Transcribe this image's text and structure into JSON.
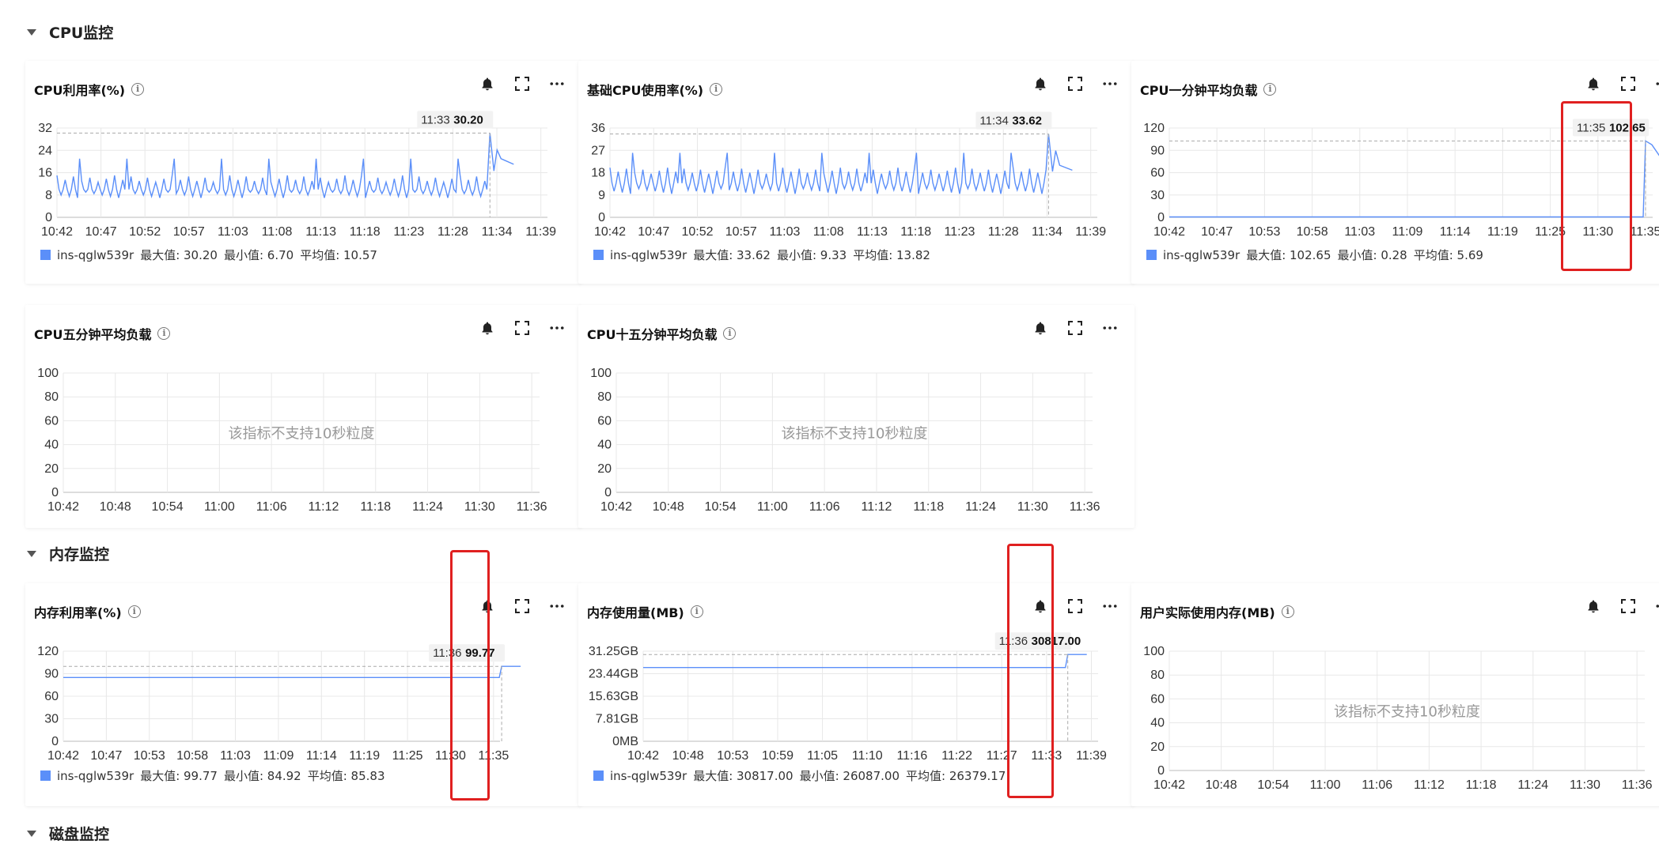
{
  "sections": {
    "cpu": {
      "title": "CPU监控"
    },
    "memory": {
      "title": "内存监控"
    },
    "disk": {
      "title": "磁盘监控"
    }
  },
  "no_data_text": "该指标不支持10秒粒度",
  "icons": {
    "alert": "bell-icon",
    "fullscreen": "fullscreen-icon",
    "more": "more-icon",
    "info": "info-icon"
  },
  "colors": {
    "series": "#5b8ff9",
    "highlight": "#e02020",
    "grid": "#e8e8e8"
  },
  "cards": [
    {
      "title": "CPU利用率(%)",
      "legend": {
        "series": "ins-qglw539r",
        "max": "最大值: 30.20",
        "min": "最小值: 6.70",
        "avg": "平均值: 10.57"
      },
      "tooltip": {
        "time": "11:33",
        "value": "30.20"
      }
    },
    {
      "title": "基础CPU使用率(%)",
      "legend": {
        "series": "ins-qglw539r",
        "max": "最大值: 33.62",
        "min": "最小值: 9.33",
        "avg": "平均值: 13.82"
      },
      "tooltip": {
        "time": "11:34",
        "value": "33.62"
      }
    },
    {
      "title": "CPU一分钟平均负载",
      "legend": {
        "series": "ins-qglw539r",
        "max": "最大值: 102.65",
        "min": "最小值: 0.28",
        "avg": "平均值: 5.69"
      },
      "tooltip": {
        "time": "11:35",
        "value": "102.65"
      }
    },
    {
      "title": "CPU五分钟平均负载"
    },
    {
      "title": "CPU十五分钟平均负载"
    },
    {
      "title": "内存利用率(%)",
      "legend": {
        "series": "ins-qglw539r",
        "max": "最大值: 99.77",
        "min": "最小值: 84.92",
        "avg": "平均值: 85.83"
      },
      "tooltip": {
        "time": "11:36",
        "value": "99.77"
      }
    },
    {
      "title": "内存使用量(MB)",
      "legend": {
        "series": "ins-qglw539r",
        "max": "最大值: 30817.00",
        "min": "最小值: 26087.00",
        "avg": "平均值: 26379.17"
      },
      "tooltip": {
        "time": "11:36",
        "value": "30817.00"
      }
    },
    {
      "title": "用户实际使用内存(MB)"
    }
  ],
  "chart_data": [
    {
      "type": "line",
      "title": "CPU利用率(%)",
      "yticks": [
        "0",
        "8",
        "16",
        "24",
        "32"
      ],
      "ylim": [
        0,
        32
      ],
      "xticks": [
        "10:42",
        "10:47",
        "10:52",
        "10:57",
        "11:03",
        "11:08",
        "11:13",
        "11:18",
        "11:23",
        "11:28",
        "11:34",
        "11:39"
      ],
      "series": [
        {
          "name": "ins-qglw539r",
          "pattern": "oscillating",
          "low": 7,
          "high": 15,
          "spike_at": "11:33",
          "spike_value": 30.2,
          "end_value": 19
        }
      ]
    },
    {
      "type": "line",
      "title": "基础CPU使用率(%)",
      "yticks": [
        "0",
        "9",
        "18",
        "27",
        "36"
      ],
      "ylim": [
        0,
        36
      ],
      "xticks": [
        "10:42",
        "10:47",
        "10:52",
        "10:57",
        "11:03",
        "11:08",
        "11:13",
        "11:18",
        "11:23",
        "11:28",
        "11:34",
        "11:39"
      ],
      "series": [
        {
          "name": "ins-qglw539r",
          "pattern": "oscillating",
          "low": 9.5,
          "high": 20,
          "spike_at": "11:34",
          "spike_value": 33.62,
          "end_value": 19
        }
      ]
    },
    {
      "type": "line",
      "title": "CPU一分钟平均负载",
      "yticks": [
        "0",
        "30",
        "60",
        "90",
        "120"
      ],
      "ylim": [
        0,
        120
      ],
      "xticks": [
        "10:42",
        "10:47",
        "10:53",
        "10:58",
        "11:03",
        "11:09",
        "11:14",
        "11:19",
        "11:25",
        "11:30",
        "11:35"
      ],
      "series": [
        {
          "name": "ins-qglw539r",
          "pattern": "flat",
          "low": 0.5,
          "spike_at": "11:35",
          "spike_value": 102.65,
          "end_value": 82
        }
      ]
    },
    {
      "type": "line",
      "title": "CPU五分钟平均负载",
      "yticks": [
        "0",
        "20",
        "40",
        "60",
        "80",
        "100"
      ],
      "ylim": [
        0,
        100
      ],
      "xticks": [
        "10:42",
        "10:48",
        "10:54",
        "11:00",
        "11:06",
        "11:12",
        "11:18",
        "11:24",
        "11:30",
        "11:36"
      ],
      "series": []
    },
    {
      "type": "line",
      "title": "CPU十五分钟平均负载",
      "yticks": [
        "0",
        "20",
        "40",
        "60",
        "80",
        "100"
      ],
      "ylim": [
        0,
        100
      ],
      "xticks": [
        "10:42",
        "10:48",
        "10:54",
        "11:00",
        "11:06",
        "11:12",
        "11:18",
        "11:24",
        "11:30",
        "11:36"
      ],
      "series": []
    },
    {
      "type": "line",
      "title": "内存利用率(%)",
      "yticks": [
        "0",
        "30",
        "60",
        "90",
        "120"
      ],
      "ylim": [
        0,
        120
      ],
      "xticks": [
        "10:42",
        "10:47",
        "10:53",
        "10:58",
        "11:03",
        "11:09",
        "11:14",
        "11:19",
        "11:25",
        "11:30",
        "11:35"
      ],
      "series": [
        {
          "name": "ins-qglw539r",
          "pattern": "flat",
          "low": 85,
          "spike_at": "11:36",
          "spike_value": 99.77,
          "end_value": 99.77
        }
      ]
    },
    {
      "type": "line",
      "title": "内存使用量(MB)",
      "yticks": [
        "0MB",
        "7.81GB",
        "15.63GB",
        "23.44GB",
        "31.25GB"
      ],
      "ylim": [
        0,
        32000
      ],
      "xticks": [
        "10:42",
        "10:48",
        "10:53",
        "10:59",
        "11:05",
        "11:10",
        "11:16",
        "11:22",
        "11:27",
        "11:33",
        "11:39"
      ],
      "series": [
        {
          "name": "ins-qglw539r",
          "pattern": "flat",
          "low": 26200,
          "spike_at": "11:36",
          "spike_value": 30817,
          "end_value": 30817
        }
      ]
    },
    {
      "type": "line",
      "title": "用户实际使用内存(MB)",
      "yticks": [
        "0",
        "20",
        "40",
        "60",
        "80",
        "100"
      ],
      "ylim": [
        0,
        100
      ],
      "xticks": [
        "10:42",
        "10:48",
        "10:54",
        "11:00",
        "11:06",
        "11:12",
        "11:18",
        "11:24",
        "11:30",
        "11:36"
      ],
      "series": []
    }
  ]
}
